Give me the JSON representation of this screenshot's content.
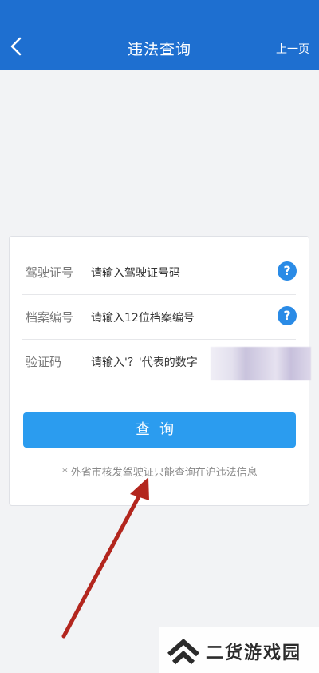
{
  "nav": {
    "title": "违法查询",
    "right_label": "上一页",
    "back_icon": "chevron-left-icon"
  },
  "form": {
    "rows": [
      {
        "label": "驾驶证号",
        "placeholder": "请输入驾驶证号码",
        "help_icon": "question-icon"
      },
      {
        "label": "档案编号",
        "placeholder": "请输入12位档案编号",
        "help_icon": "question-icon"
      },
      {
        "label": "验证码",
        "placeholder": "请输入'？'代表的数字"
      }
    ],
    "query_label": "查询",
    "note": "* 外省市核发驾驶证只能查询在沪违法信息"
  },
  "watermark": {
    "text": "二货游戏园"
  },
  "colors": {
    "nav": "#1e6fd0",
    "button": "#2b9cef",
    "help": "#2a8be6",
    "arrow": "#b3261e"
  }
}
